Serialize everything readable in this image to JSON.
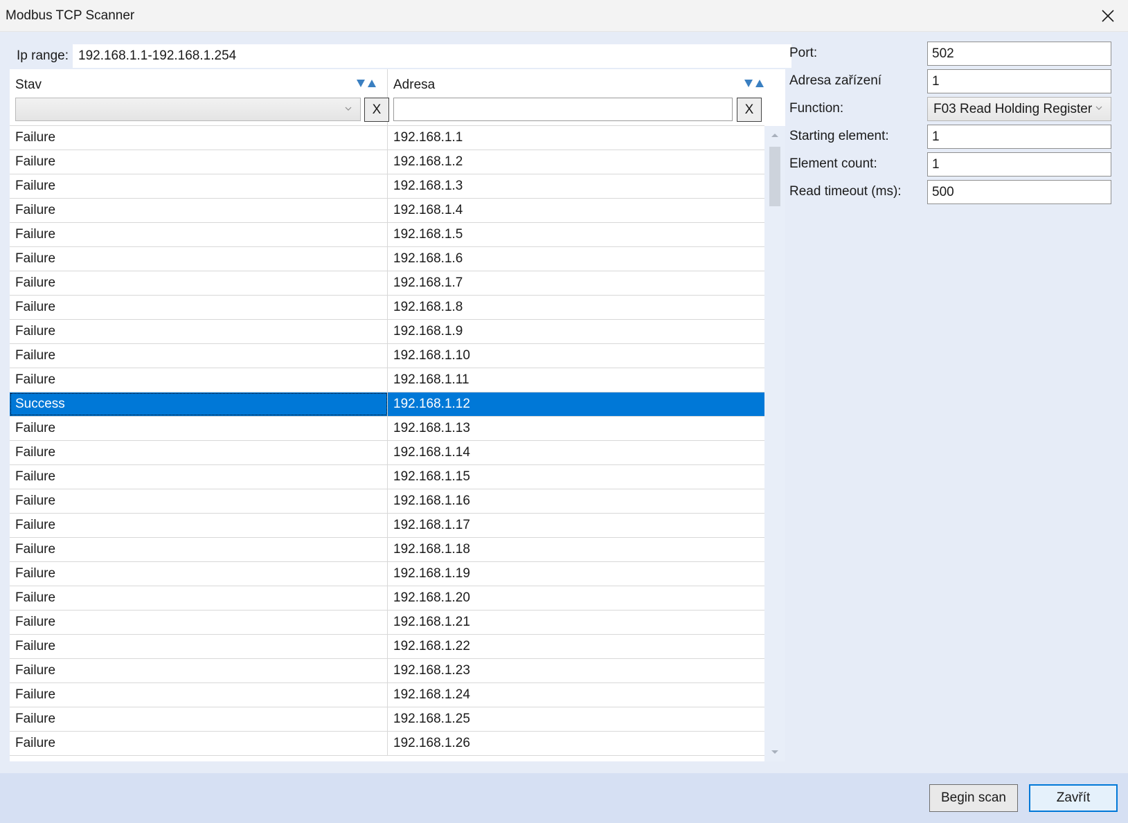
{
  "window": {
    "title": "Modbus TCP Scanner",
    "close_icon": "close-icon"
  },
  "iprange": {
    "label": "Ip range:",
    "value": "192.168.1.1-192.168.1.254"
  },
  "grid": {
    "columns": [
      {
        "label": "Stav",
        "filter_clear": "X"
      },
      {
        "label": "Adresa",
        "filter_clear": "X"
      }
    ],
    "stav_filter_value": "",
    "adresa_filter_value": "",
    "selected_index": 11,
    "rows": [
      {
        "stav": "Failure",
        "adresa": "192.168.1.1"
      },
      {
        "stav": "Failure",
        "adresa": "192.168.1.2"
      },
      {
        "stav": "Failure",
        "adresa": "192.168.1.3"
      },
      {
        "stav": "Failure",
        "adresa": "192.168.1.4"
      },
      {
        "stav": "Failure",
        "adresa": "192.168.1.5"
      },
      {
        "stav": "Failure",
        "adresa": "192.168.1.6"
      },
      {
        "stav": "Failure",
        "adresa": "192.168.1.7"
      },
      {
        "stav": "Failure",
        "adresa": "192.168.1.8"
      },
      {
        "stav": "Failure",
        "adresa": "192.168.1.9"
      },
      {
        "stav": "Failure",
        "adresa": "192.168.1.10"
      },
      {
        "stav": "Failure",
        "adresa": "192.168.1.11"
      },
      {
        "stav": "Success",
        "adresa": "192.168.1.12"
      },
      {
        "stav": "Failure",
        "adresa": "192.168.1.13"
      },
      {
        "stav": "Failure",
        "adresa": "192.168.1.14"
      },
      {
        "stav": "Failure",
        "adresa": "192.168.1.15"
      },
      {
        "stav": "Failure",
        "adresa": "192.168.1.16"
      },
      {
        "stav": "Failure",
        "adresa": "192.168.1.17"
      },
      {
        "stav": "Failure",
        "adresa": "192.168.1.18"
      },
      {
        "stav": "Failure",
        "adresa": "192.168.1.19"
      },
      {
        "stav": "Failure",
        "adresa": "192.168.1.20"
      },
      {
        "stav": "Failure",
        "adresa": "192.168.1.21"
      },
      {
        "stav": "Failure",
        "adresa": "192.168.1.22"
      },
      {
        "stav": "Failure",
        "adresa": "192.168.1.23"
      },
      {
        "stav": "Failure",
        "adresa": "192.168.1.24"
      },
      {
        "stav": "Failure",
        "adresa": "192.168.1.25"
      },
      {
        "stav": "Failure",
        "adresa": "192.168.1.26"
      }
    ]
  },
  "form": {
    "port": {
      "label": "Port:",
      "value": "502"
    },
    "device_address": {
      "label": "Adresa zařízení",
      "value": "1"
    },
    "function": {
      "label": "Function:",
      "value": "F03 Read Holding Register"
    },
    "starting_element": {
      "label": "Starting element:",
      "value": "1"
    },
    "element_count": {
      "label": "Element count:",
      "value": "1"
    },
    "read_timeout": {
      "label": "Read timeout (ms):",
      "value": "500"
    }
  },
  "footer": {
    "begin_scan": "Begin scan",
    "close": "Zavřít"
  },
  "colors": {
    "selection": "#0078d7",
    "client_background": "#e6ecf7",
    "footer_background": "#d6e0f3",
    "sort_arrows": "#3a7fc1"
  }
}
